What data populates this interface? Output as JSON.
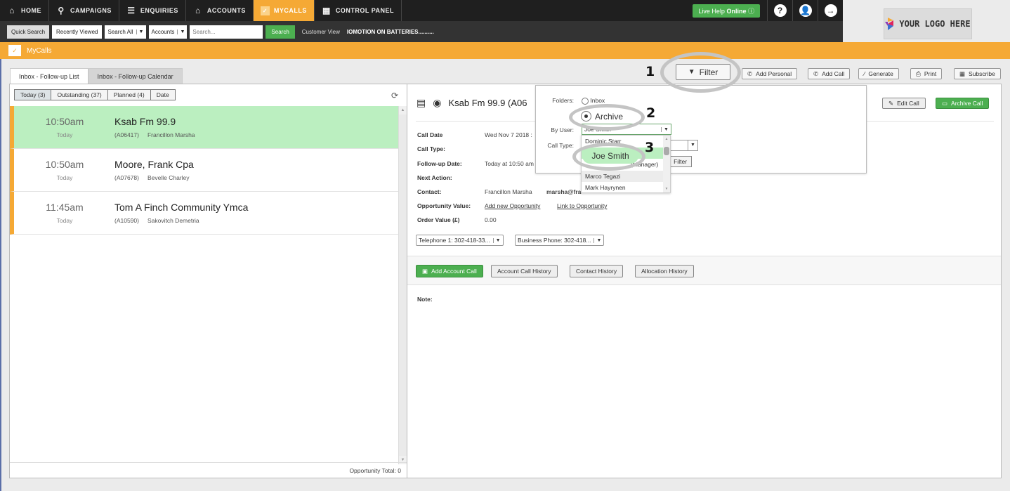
{
  "nav": {
    "items": [
      {
        "label": "HOME",
        "icon": "home-icon"
      },
      {
        "label": "CAMPAIGNS",
        "icon": "campaigns-icon"
      },
      {
        "label": "ENQUIRIES",
        "icon": "enquiries-icon"
      },
      {
        "label": "ACCOUNTS",
        "icon": "bank-icon"
      },
      {
        "label": "MYCALLS",
        "icon": "checklist-icon",
        "active": true
      },
      {
        "label": "CONTROL PANEL",
        "icon": "grid-icon"
      }
    ],
    "live_help": "Live Help",
    "live_help_status": "Online",
    "help_glyph": "?",
    "user_glyph": "●",
    "logout_glyph": "→"
  },
  "searchbar": {
    "quick_search": "Quick Search",
    "recently_viewed": "Recently Viewed",
    "scope": "Search All",
    "entity": "Accounts",
    "placeholder": "Search...",
    "search_button": "Search",
    "customer_view": "Customer View",
    "promo": "IOMOTION ON BATTERIES..........",
    "arrow": "▼"
  },
  "logo": {
    "text": "YOUR LOGO HERE"
  },
  "section": {
    "title": "MyCalls"
  },
  "tabs": [
    {
      "label": "Inbox - Follow-up List",
      "active": true
    },
    {
      "label": "Inbox - Follow-up Calendar",
      "active": false
    }
  ],
  "list_filters": [
    {
      "label": "Today (3)",
      "active": true
    },
    {
      "label": "Outstanding (37)"
    },
    {
      "label": "Planned (4)"
    },
    {
      "label": "Date"
    }
  ],
  "calls": [
    {
      "time": "10:50am",
      "when": "Today",
      "name": "Ksab Fm 99.9",
      "account": "(A06417)",
      "contact": "Francillon Marsha",
      "selected": true
    },
    {
      "time": "10:50am",
      "when": "Today",
      "name": "Moore, Frank Cpa",
      "account": "(A07678)",
      "contact": "Bevelle Charley"
    },
    {
      "time": "11:45am",
      "when": "Today",
      "name": "Tom A Finch Community Ymca",
      "account": "(A10590)",
      "contact": "Sakovitch Demetria"
    }
  ],
  "opportunity_total": "Opportunity Total:  0",
  "toolbar": {
    "filter": "Filter",
    "add_personal": "Add Personal",
    "add_call": "Add Call",
    "generate": "Generate",
    "print": "Print",
    "subscribe": "Subscribe"
  },
  "detail": {
    "title": "Ksab Fm 99.9 (A06",
    "edit_call": "Edit Call",
    "archive_call": "Archive Call",
    "fields": {
      "call_date_label": "Call Date",
      "call_date_value": "Wed Nov 7 2018 :",
      "call_type_label": "Call Type:",
      "followup_label": "Follow-up Date:",
      "followup_value": "Today at 10:50 am",
      "next_action_label": "Next Action:",
      "contact_label": "Contact:",
      "contact_value": "Francillon Marsha",
      "contact_email": "marsha@fra",
      "opp_label": "Opportunity Value:",
      "opp_add": "Add new Opportunity",
      "opp_link": "Link to Opportunity",
      "order_label": "Order Value (£)",
      "order_value": "0.00"
    },
    "phone1": "Telephone 1: 302-418-33...",
    "phone2": "Business Phone: 302-418...",
    "actions": {
      "add_account_call": "Add Account Call",
      "account_call_history": "Account Call History",
      "contact_history": "Contact History",
      "allocation_history": "Allocation History"
    },
    "note_label": "Note:"
  },
  "filter_popup": {
    "folders_label": "Folders:",
    "inbox": "Inbox",
    "archive": "Archive",
    "by_user_label": "By User:",
    "by_user_value": "Joe Smith",
    "call_type_label": "Call Type:",
    "filter_button": "Filter",
    "users": [
      {
        "name": "Dominic Starr"
      },
      {
        "name": "Joe Smith",
        "selected": true
      },
      {
        "name": "(Manager)"
      },
      {
        "name": "Marco Tegazi",
        "hover": true
      },
      {
        "name": "Mark Hayrynen"
      }
    ]
  },
  "annotations": [
    "1",
    "2",
    "3"
  ]
}
